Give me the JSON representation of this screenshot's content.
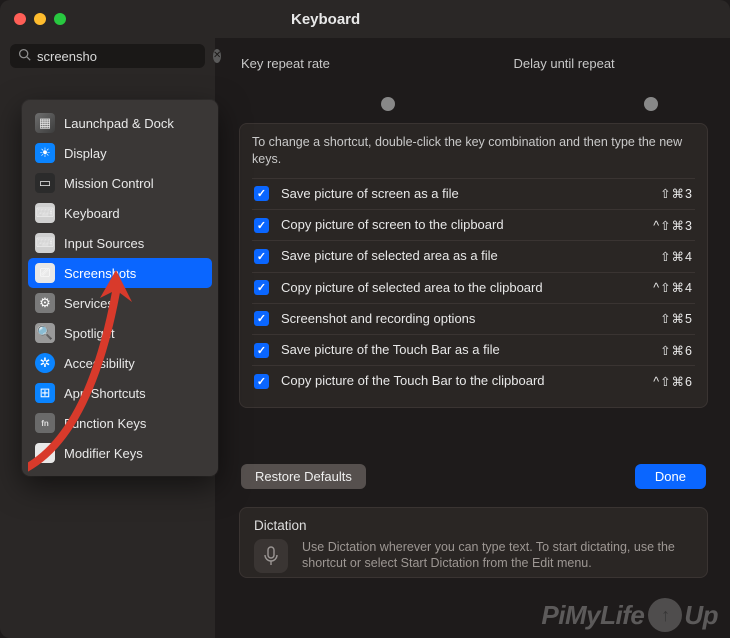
{
  "window": {
    "title": "Keyboard"
  },
  "search": {
    "value": "screensho"
  },
  "section": {
    "key_repeat_label": "Key repeat rate",
    "delay_label": "Delay until repeat"
  },
  "popover": {
    "items": [
      {
        "label": "Launchpad & Dock",
        "icon": "launchpad-icon",
        "selected": false
      },
      {
        "label": "Display",
        "icon": "display-icon",
        "selected": false
      },
      {
        "label": "Mission Control",
        "icon": "mission-control-icon",
        "selected": false
      },
      {
        "label": "Keyboard",
        "icon": "keyboard-icon",
        "selected": false
      },
      {
        "label": "Input Sources",
        "icon": "input-sources-icon",
        "selected": false
      },
      {
        "label": "Screenshots",
        "icon": "screenshots-icon",
        "selected": true
      },
      {
        "label": "Services",
        "icon": "services-icon",
        "selected": false
      },
      {
        "label": "Spotlight",
        "icon": "spotlight-icon",
        "selected": false
      },
      {
        "label": "Accessibility",
        "icon": "accessibility-icon",
        "selected": false
      },
      {
        "label": "App Shortcuts",
        "icon": "app-shortcuts-icon",
        "selected": false
      },
      {
        "label": "Function Keys",
        "icon": "function-keys-icon",
        "selected": false
      },
      {
        "label": "Modifier Keys",
        "icon": "modifier-keys-icon",
        "selected": false
      }
    ]
  },
  "panel": {
    "hint": "To change a shortcut, double-click the key combination and then type the new keys.",
    "rows": [
      {
        "enabled": true,
        "label": "Save picture of screen as a file",
        "keys": "⇧⌘3"
      },
      {
        "enabled": true,
        "label": "Copy picture of screen to the clipboard",
        "keys": "^⇧⌘3"
      },
      {
        "enabled": true,
        "label": "Save picture of selected area as a file",
        "keys": "⇧⌘4"
      },
      {
        "enabled": true,
        "label": "Copy picture of selected area to the clipboard",
        "keys": "^⇧⌘4"
      },
      {
        "enabled": true,
        "label": "Screenshot and recording options",
        "keys": "⇧⌘5"
      },
      {
        "enabled": true,
        "label": "Save picture of the Touch Bar as a file",
        "keys": "⇧⌘6"
      },
      {
        "enabled": true,
        "label": "Copy picture of the Touch Bar to the clipboard",
        "keys": "^⇧⌘6"
      }
    ]
  },
  "buttons": {
    "restore": "Restore Defaults",
    "done": "Done"
  },
  "dictation": {
    "heading": "Dictation",
    "body": "Use Dictation wherever you can type text. To start dictating, use the shortcut or select Start Dictation from the Edit menu."
  },
  "watermark": {
    "text": "PiMyLife",
    "suffix": "Up"
  }
}
